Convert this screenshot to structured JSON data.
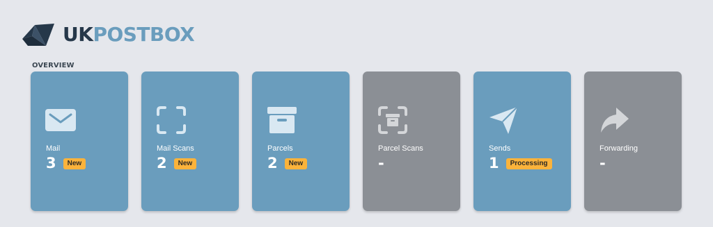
{
  "brand": {
    "name_part1": "UK",
    "name_part2": "POSTBOX",
    "colors": {
      "dark": "#26384a",
      "accent": "#6a9dbd"
    }
  },
  "overview": {
    "title": "OVERVIEW",
    "cards": [
      {
        "label": "Mail",
        "value": "3",
        "badge": "New",
        "icon": "envelope-icon",
        "state": "active"
      },
      {
        "label": "Mail Scans",
        "value": "2",
        "badge": "New",
        "icon": "scan-frame-icon",
        "state": "active"
      },
      {
        "label": "Parcels",
        "value": "2",
        "badge": "New",
        "icon": "archive-box-icon",
        "state": "active"
      },
      {
        "label": "Parcel Scans",
        "value": "-",
        "badge": "",
        "icon": "parcel-scan-icon",
        "state": "inactive"
      },
      {
        "label": "Sends",
        "value": "1",
        "badge": "Processing",
        "icon": "paper-plane-icon",
        "state": "active"
      },
      {
        "label": "Forwarding",
        "value": "-",
        "badge": "",
        "icon": "forward-arrow-icon",
        "state": "inactive"
      }
    ]
  },
  "colors": {
    "card_active": "#6a9dbd",
    "card_inactive": "#8b8f95",
    "badge": "#fbb33b",
    "background": "#e5e7ec"
  }
}
